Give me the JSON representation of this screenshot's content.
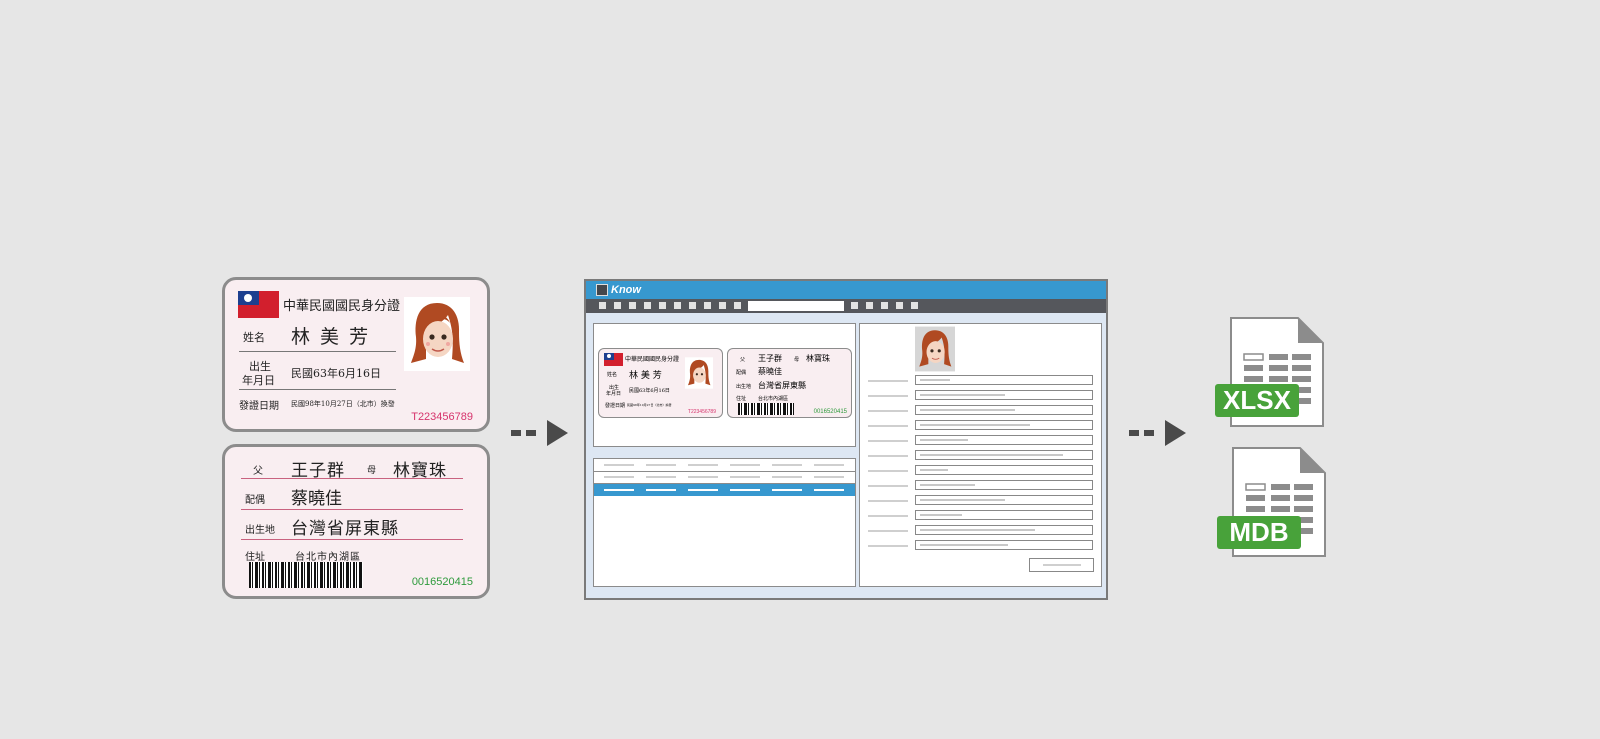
{
  "card_front": {
    "title": "中華民國國民身分證",
    "name_label": "姓名",
    "name": "林 美 芳",
    "birth_label_1": "出生",
    "birth_label_2": "年月日",
    "birth_date": "民國63年6月16日",
    "issue_label": "發證日期",
    "issue_date": "民國98年10月27日（北市）換發",
    "id_number": "T223456789"
  },
  "card_back": {
    "father_label": "父",
    "father": "王子群",
    "mother_label": "母",
    "mother": "林寶珠",
    "spouse_label": "配偶",
    "spouse": "蔡曉佳",
    "birthplace_label": "出生地",
    "birthplace": "台灣省屏東縣",
    "address_label": "住址",
    "address": "台北市內湖區",
    "serial": "0016520415"
  },
  "app": {
    "title": "Know"
  },
  "exports": [
    {
      "label": "XLSX"
    },
    {
      "label": "MDB"
    }
  ],
  "colors": {
    "card_bg": "#f9eef1",
    "card_rule": "#c9627f",
    "id_number": "#d6336c",
    "serial": "#2e9a3c",
    "titlebar": "#3798cf",
    "toolbar": "#55575c",
    "selected_row": "#3798cf",
    "export_badge": "#48a23a"
  },
  "icons": [
    "taiwan-flag-icon",
    "portrait-icon",
    "barcode-icon",
    "app-logo-icon",
    "arrow-right-icon",
    "spreadsheet-file-icon",
    "database-file-icon"
  ]
}
